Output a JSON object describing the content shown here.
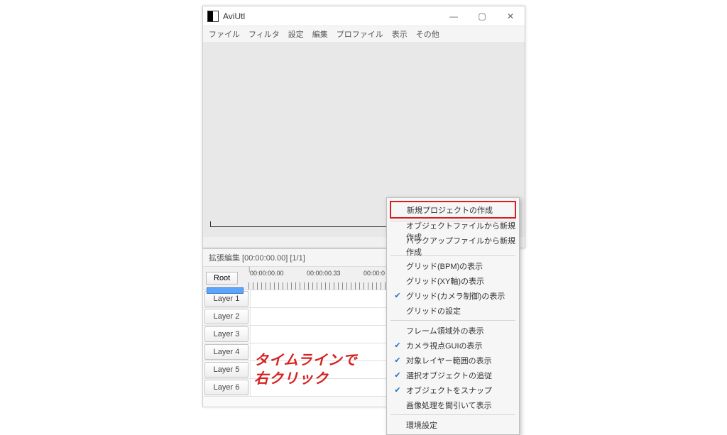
{
  "mainWindow": {
    "title": "AviUtl",
    "menu": [
      "ファイル",
      "フィルタ",
      "設定",
      "編集",
      "プロファイル",
      "表示",
      "その他"
    ]
  },
  "timeline": {
    "title": "拡張編集 [00:00:00.00] [1/1]",
    "rootLabel": "Root",
    "timestamps": [
      "00:00:00.00",
      "00:00:00.33",
      "00:00:0"
    ],
    "layers": [
      "Layer 1",
      "Layer 2",
      "Layer 3",
      "Layer 4",
      "Layer 5",
      "Layer 6"
    ]
  },
  "annotation": {
    "line1": "タイムラインで",
    "line2": "右クリック"
  },
  "contextMenu": {
    "groups": [
      {
        "items": [
          {
            "label": "新規プロジェクトの作成",
            "highlight": true
          }
        ]
      },
      {
        "items": [
          {
            "label": "オブジェクトファイルから新規作成"
          },
          {
            "label": "バックアップファイルから新規作成"
          }
        ]
      },
      {
        "items": [
          {
            "label": "グリッド(BPM)の表示"
          },
          {
            "label": "グリッド(XY軸)の表示"
          },
          {
            "label": "グリッド(カメラ制御)の表示",
            "checked": true
          },
          {
            "label": "グリッドの設定"
          }
        ]
      },
      {
        "items": [
          {
            "label": "フレーム領域外の表示"
          },
          {
            "label": "カメラ視点GUIの表示",
            "checked": true
          },
          {
            "label": "対象レイヤー範囲の表示",
            "checked": true
          },
          {
            "label": "選択オブジェクトの追従",
            "checked": true
          },
          {
            "label": "オブジェクトをスナップ",
            "checked": true
          },
          {
            "label": "画像処理を間引いて表示"
          }
        ]
      },
      {
        "items": [
          {
            "label": "環境設定"
          }
        ]
      }
    ]
  },
  "winControls": {
    "min": "—",
    "max": "▢",
    "close": "✕"
  }
}
